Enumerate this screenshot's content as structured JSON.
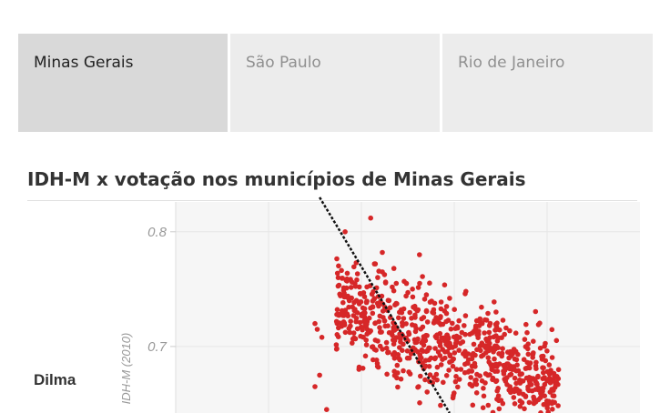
{
  "tabs": [
    {
      "label": "Minas Gerais",
      "active": true
    },
    {
      "label": "São Paulo",
      "active": false
    },
    {
      "label": "Rio de Janeiro",
      "active": false
    }
  ],
  "chart_title": "IDH-M x votação nos municípios de Minas Gerais",
  "side_label": "Dilma",
  "chart_data": {
    "type": "scatter",
    "title": "IDH-M x votação nos municípios de Minas Gerais",
    "xlabel": "",
    "ylabel": "IDH-M (2010)",
    "ylim": [
      0.642,
      0.826
    ],
    "xlim": [
      0,
      1
    ],
    "y_ticks": [
      0.7,
      0.8
    ],
    "y_tick_labels": [
      "0.7",
      "0.8"
    ],
    "grid": true,
    "point_color": "#d62728",
    "trendline": {
      "style": "dashed",
      "color": "#111111",
      "points": [
        [
          0.31,
          0.83
        ],
        [
          0.59,
          0.642
        ]
      ]
    },
    "series": [
      {
        "x": [
          0.3,
          0.305,
          0.315,
          0.31,
          0.3,
          0.325,
          0.365,
          0.35,
          0.39,
          0.36,
          0.42,
          0.43,
          0.38,
          0.445,
          0.445,
          0.395,
          0.46,
          0.47,
          0.475,
          0.48,
          0.5,
          0.51,
          0.515,
          0.525,
          0.53,
          0.54,
          0.55,
          0.57,
          0.58,
          0.585,
          0.59,
          0.605,
          0.625,
          0.66,
          0.69,
          0.72,
          0.8
        ],
        "y": [
          0.72,
          0.715,
          0.708,
          0.675,
          0.665,
          0.645,
          0.8,
          0.76,
          0.758,
          0.727,
          0.812,
          0.772,
          0.703,
          0.782,
          0.765,
          0.682,
          0.712,
          0.768,
          0.755,
          0.725,
          0.705,
          0.75,
          0.735,
          0.78,
          0.697,
          0.745,
          0.69,
          0.725,
          0.69,
          0.71,
          0.742,
          0.68,
          0.748,
          0.67,
          0.73,
          0.665,
          0.67
        ]
      }
    ]
  }
}
